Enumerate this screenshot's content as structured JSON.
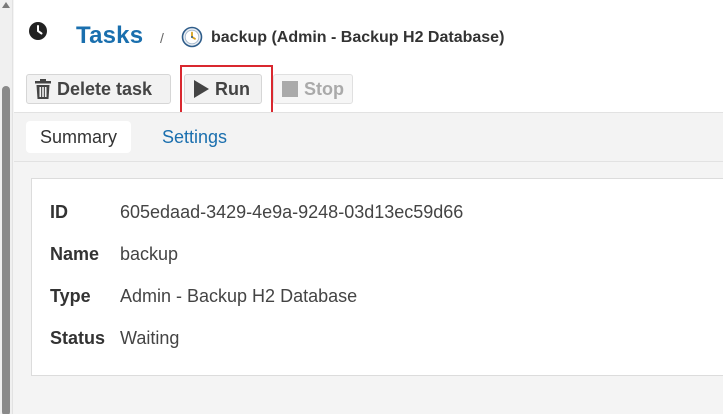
{
  "header": {
    "title": "Tasks",
    "separator": "/",
    "task_name": "backup (Admin - Backup H2 Database)"
  },
  "toolbar": {
    "delete_label": "Delete task",
    "run_label": "Run",
    "stop_label": "Stop"
  },
  "tabs": [
    {
      "label": "Summary",
      "active": true
    },
    {
      "label": "Settings",
      "active": false
    }
  ],
  "summary": {
    "rows": [
      {
        "label": "ID",
        "value": "605edaad-3429-4e9a-9248-03d13ec59d66"
      },
      {
        "label": "Name",
        "value": "backup"
      },
      {
        "label": "Type",
        "value": "Admin - Backup H2 Database"
      },
      {
        "label": "Status",
        "value": "Waiting"
      }
    ]
  },
  "colors": {
    "accent": "#1a6fae",
    "highlight": "#d9282f"
  },
  "icons": [
    "clock-icon",
    "task-clock-icon",
    "trash-icon",
    "play-icon",
    "stop-icon"
  ]
}
